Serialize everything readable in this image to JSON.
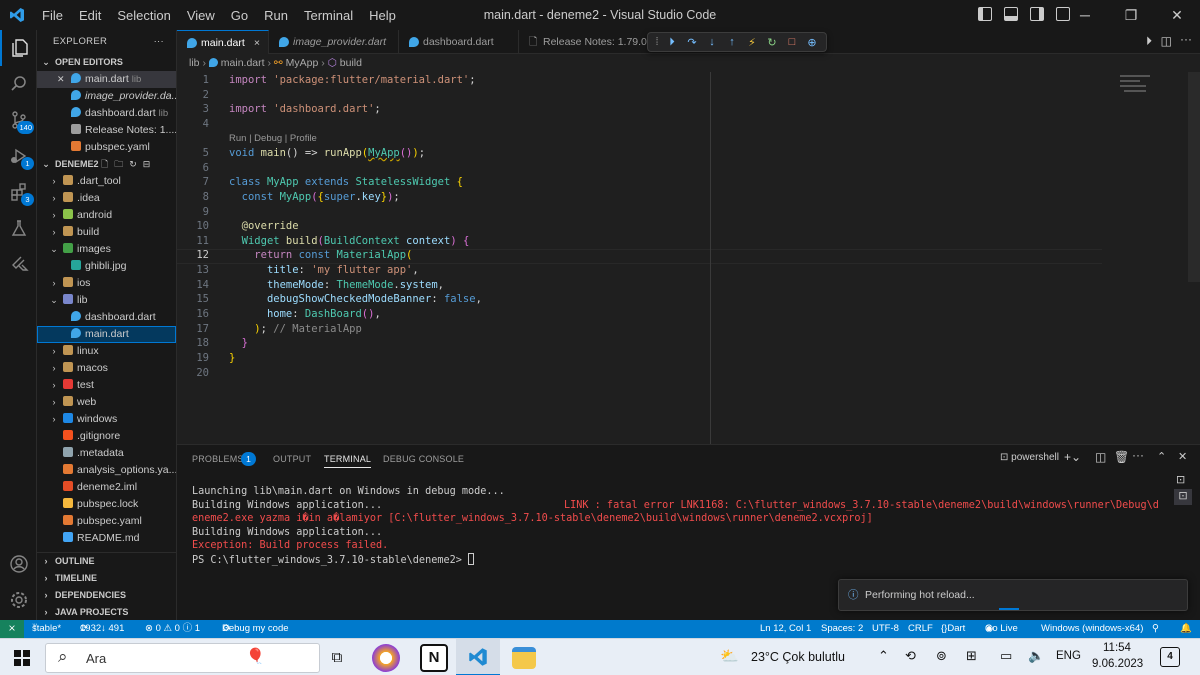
{
  "titlebar": {
    "menu": [
      "File",
      "Edit",
      "Selection",
      "View",
      "Go",
      "Run",
      "Terminal",
      "Help"
    ],
    "title": "main.dart - deneme2 - Visual Studio Code"
  },
  "activity": {
    "scm_badge": "140",
    "debug_badge": "1",
    "ext_badge": "3"
  },
  "sidebar": {
    "title": "EXPLORER",
    "more": "···",
    "open_editors_label": "OPEN EDITORS",
    "open_editors": [
      {
        "name": "main.dart",
        "hint": "lib",
        "icon": "dart"
      },
      {
        "name": "image_provider.da...",
        "hint": "",
        "icon": "dart",
        "italic": true
      },
      {
        "name": "dashboard.dart",
        "hint": "lib",
        "icon": "dart"
      },
      {
        "name": "Release Notes: 1....",
        "hint": "",
        "icon": "doc"
      },
      {
        "name": "pubspec.yaml",
        "hint": "",
        "icon": "yaml"
      }
    ],
    "project_label": "DENEME2",
    "tree": [
      {
        "name": ".dart_tool",
        "type": "folder",
        "chev": "›",
        "depth": 0
      },
      {
        "name": ".idea",
        "type": "folder",
        "chev": "›",
        "depth": 0
      },
      {
        "name": "android",
        "type": "folder-android",
        "chev": "›",
        "depth": 0
      },
      {
        "name": "build",
        "type": "folder",
        "chev": "›",
        "depth": 0
      },
      {
        "name": "images",
        "type": "folder-images",
        "chev": "⌄",
        "depth": 0
      },
      {
        "name": "ghibli.jpg",
        "type": "image",
        "chev": "",
        "depth": 1
      },
      {
        "name": "ios",
        "type": "folder",
        "chev": "›",
        "depth": 0
      },
      {
        "name": "lib",
        "type": "folder-lib",
        "chev": "⌄",
        "depth": 0
      },
      {
        "name": "dashboard.dart",
        "type": "dart",
        "chev": "",
        "depth": 1
      },
      {
        "name": "main.dart",
        "type": "dart",
        "chev": "",
        "depth": 1,
        "active": true
      },
      {
        "name": "linux",
        "type": "folder",
        "chev": "›",
        "depth": 0
      },
      {
        "name": "macos",
        "type": "folder",
        "chev": "›",
        "depth": 0
      },
      {
        "name": "test",
        "type": "folder-test",
        "chev": "›",
        "depth": 0
      },
      {
        "name": "web",
        "type": "folder",
        "chev": "›",
        "depth": 0
      },
      {
        "name": "windows",
        "type": "folder-win",
        "chev": "›",
        "depth": 0
      },
      {
        "name": ".gitignore",
        "type": "git",
        "chev": "",
        "depth": 0
      },
      {
        "name": ".metadata",
        "type": "meta",
        "chev": "",
        "depth": 0
      },
      {
        "name": "analysis_options.ya...",
        "type": "yaml",
        "chev": "",
        "depth": 0
      },
      {
        "name": "deneme2.iml",
        "type": "xml",
        "chev": "",
        "depth": 0
      },
      {
        "name": "pubspec.lock",
        "type": "lock",
        "chev": "",
        "depth": 0
      },
      {
        "name": "pubspec.yaml",
        "type": "yaml",
        "chev": "",
        "depth": 0
      },
      {
        "name": "README.md",
        "type": "md",
        "chev": "",
        "depth": 0
      }
    ],
    "bottom_sections": [
      "OUTLINE",
      "TIMELINE",
      "DEPENDENCIES",
      "JAVA PROJECTS"
    ]
  },
  "tabs": [
    {
      "label": "main.dart",
      "close": "×"
    },
    {
      "label": "image_provider.dart"
    },
    {
      "label": "dashboard.dart"
    },
    {
      "label": "Release Notes: 1.79.0"
    }
  ],
  "breadcrumb": [
    "lib",
    "main.dart",
    "MyApp",
    "build"
  ],
  "editor": {
    "codelens": "Run | Debug | Profile",
    "line_numbers": [
      "1",
      "2",
      "3",
      "4",
      "5",
      "6",
      "7",
      "8",
      "9",
      "10",
      "11",
      "12",
      "13",
      "14",
      "15",
      "16",
      "17",
      "18",
      "19",
      "20"
    ],
    "current_line": "12"
  },
  "panel": {
    "tabs": [
      "PROBLEMS",
      "OUTPUT",
      "TERMINAL",
      "DEBUG CONSOLE"
    ],
    "problems_count": "1",
    "shell": "powershell",
    "terminal": [
      "Launching lib\\main.dart on Windows in debug mode...",
      "Building Windows application...",
      "LINK : fatal error LNK1168: C:\\flutter_windows_3.7.10-stable\\deneme2\\build\\windows\\runner\\Debug\\d",
      "eneme2.exe yazma i�in a�lamiyor [C:\\flutter_windows_3.7.10-stable\\deneme2\\build\\windows\\runner\\deneme2.vcxproj]",
      "Building Windows application...",
      "Exception: Build process failed.",
      "PS C:\\flutter_windows_3.7.10-stable\\deneme2> "
    ],
    "toast": "Performing hot reload..."
  },
  "status": {
    "branch": "stable*",
    "sync": "1932↓ 491",
    "problems": "⊗ 0 ⚠ 0 ⓘ 1",
    "debug": "Debug my code",
    "position": "Ln 12, Col 1",
    "spaces": "Spaces: 2",
    "encoding": "UTF-8",
    "eol": "CRLF",
    "language": "Dart",
    "golive": "Go Live",
    "device": "Windows (windows-x64)"
  },
  "taskbar": {
    "search": "Ara",
    "weather": "23°C  Çok bulutlu",
    "lang": "ENG",
    "time": "11:54",
    "date": "9.06.2023",
    "notif": "4"
  },
  "colors": {
    "accent": "#007acc",
    "error": "#f14c4c"
  }
}
